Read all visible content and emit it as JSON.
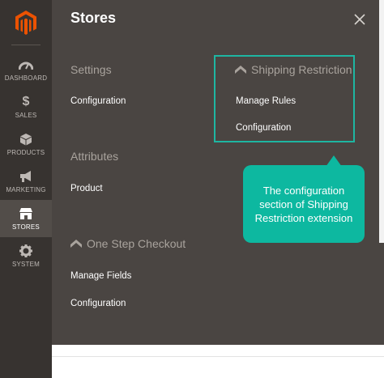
{
  "brand": {
    "logo": "magento-logo",
    "accent": "#eb5202"
  },
  "sidebar": {
    "items": [
      {
        "label": "DASHBOARD",
        "icon": "dashboard-icon",
        "active": false
      },
      {
        "label": "SALES",
        "icon": "dollar-icon",
        "active": false
      },
      {
        "label": "PRODUCTS",
        "icon": "cube-icon",
        "active": false
      },
      {
        "label": "MARKETING",
        "icon": "megaphone-icon",
        "active": false
      },
      {
        "label": "STORES",
        "icon": "stores-icon",
        "active": true
      },
      {
        "label": "SYSTEM",
        "icon": "gear-icon",
        "active": false
      }
    ]
  },
  "panel": {
    "title": "Stores",
    "close_icon": "close-icon",
    "settings": {
      "heading": "Settings",
      "links": [
        "Configuration"
      ]
    },
    "attributes": {
      "heading": "Attributes",
      "links": [
        "Product"
      ]
    },
    "one_step_checkout": {
      "heading": "One Step Checkout",
      "icon": "extension-icon",
      "links": [
        "Manage Fields",
        "Configuration"
      ]
    },
    "shipping_restriction": {
      "heading": "Shipping Restriction",
      "icon": "extension-icon",
      "links": [
        "Manage Rules",
        "Configuration"
      ]
    }
  },
  "callout": {
    "text": "The configuration section of Shipping Restriction extension",
    "color": "#0db8a0"
  }
}
